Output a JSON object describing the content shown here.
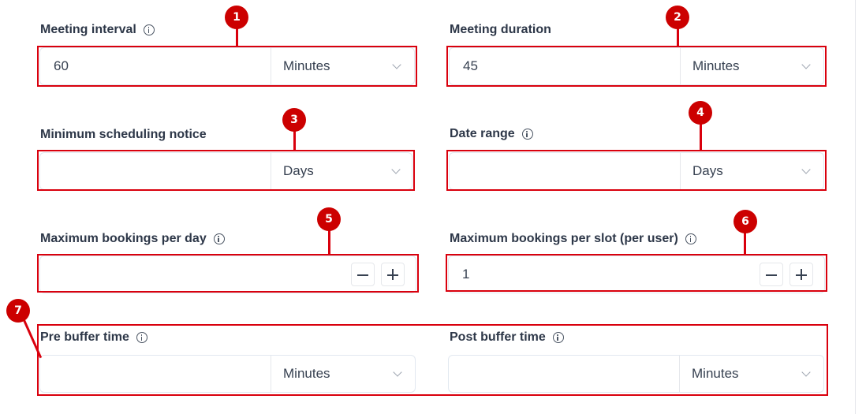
{
  "meeting_interval": {
    "label": "Meeting interval",
    "value": "60",
    "unit": "Minutes"
  },
  "meeting_duration": {
    "label": "Meeting duration",
    "value": "45",
    "unit": "Minutes"
  },
  "min_notice": {
    "label": "Minimum scheduling notice",
    "value": "",
    "unit": "Days"
  },
  "date_range": {
    "label": "Date range",
    "value": "",
    "unit": "Days"
  },
  "max_per_day": {
    "label": "Maximum bookings per day",
    "value": ""
  },
  "max_per_slot": {
    "label": "Maximum bookings per slot (per user)",
    "value": "1"
  },
  "pre_buffer": {
    "label": "Pre buffer time",
    "value": "",
    "unit": "Minutes"
  },
  "post_buffer": {
    "label": "Post buffer time",
    "value": "",
    "unit": "Minutes"
  },
  "annotations": [
    "1",
    "2",
    "3",
    "4",
    "5",
    "6",
    "7"
  ],
  "colors": {
    "highlight": "#d9000d",
    "badge": "#cc0000"
  },
  "icons": {
    "info": "info-circle-icon",
    "dropdown": "chevron-down-icon",
    "decrement": "minus-icon",
    "increment": "plus-icon"
  }
}
